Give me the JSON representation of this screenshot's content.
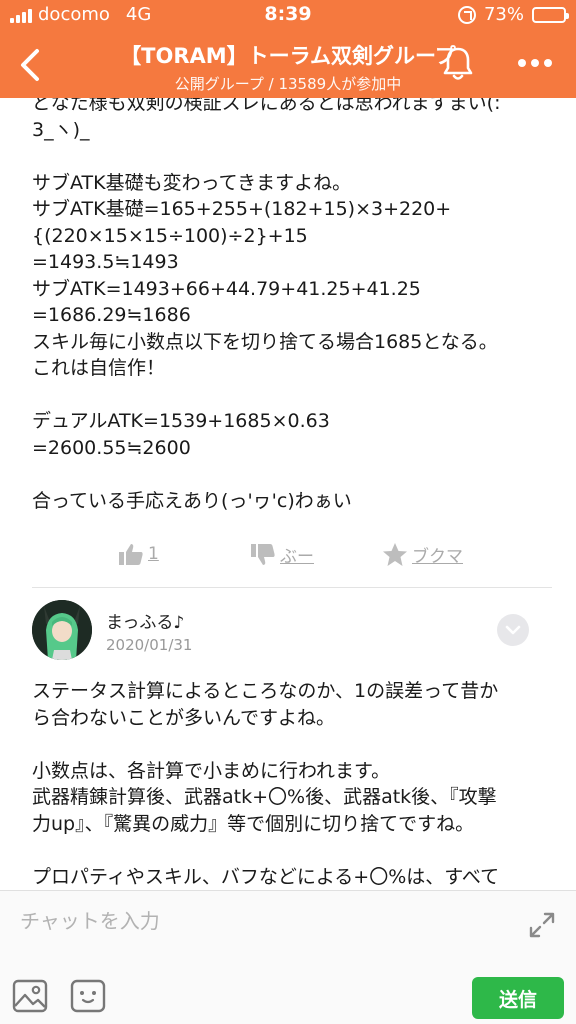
{
  "status_bar": {
    "carrier": "docomo",
    "network": "4G",
    "time": "8:39",
    "battery_percent": "73%",
    "battery_level": 0.73
  },
  "header": {
    "title": "【TORAM】トーラム双剣グループ",
    "subtitle": "公開グループ / 13589人が参加中",
    "background_color": "#f5793f"
  },
  "post": {
    "body": "どなた様も双剣の検証スレにあるとは思われますまい(:\n3_ヽ)_\n\nサブATK基礎も変わってきますよね。\nサブATK基礎=165+255+(182+15)×3+220+\n{(220×15×15÷100)÷2}+15\n=1493.5≒1493\nサブATK=1493+66+44.79+41.25+41.25\n=1686.29≒1686\nスキル毎に小数点以下を切り捨てる場合1685となる。\nこれは自信作！\n\nデュアルATK=1539+1685×0.63\n=2600.55≒2600\n\n合っている手応えあり(っ'ヮ'c)わぁい",
    "actions": {
      "like_count": "1",
      "dislike_label": "ぶー",
      "bookmark_label": "ブクマ"
    }
  },
  "comment": {
    "author": "まっふる♪",
    "date": "2020/01/31",
    "body": "ステータス計算によるところなのか、1の誤差って昔か\nら合わないことが多いんですよね。\n\n小数点は、各計算で小まめに行われます。\n武器精錬計算後、武器atk+〇%後、武器atk後、『攻撃\n力up』、『驚異の威力』等で個別に切り捨てですね。\n\nプロパティやスキル、バフなどによる+〇%は、すべて\n合算してから一度にかけます。"
  },
  "composer": {
    "placeholder": "チャットを入力",
    "send_label": "送信",
    "send_color": "#2eb849"
  }
}
